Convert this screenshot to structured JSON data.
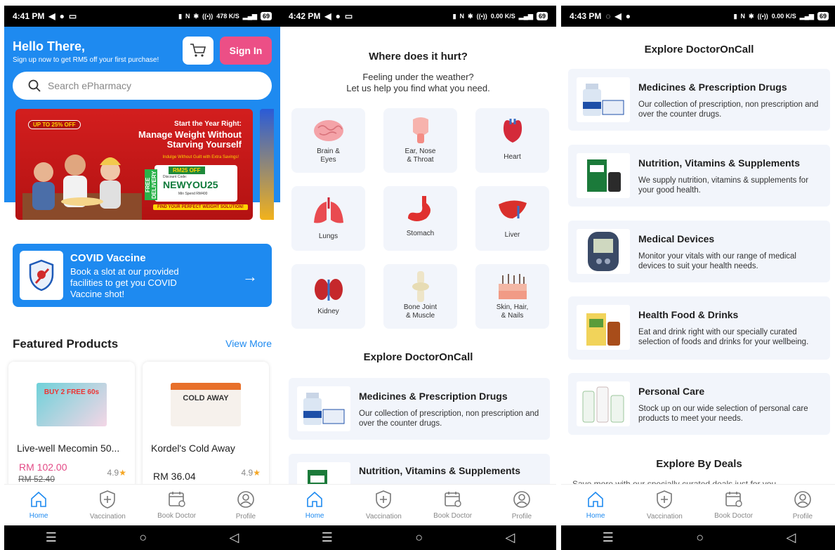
{
  "screens": [
    {
      "status": {
        "time": "4:41 PM",
        "speed": "478 K/S",
        "battery": "69"
      },
      "header": {
        "greeting": "Hello There,",
        "subtitle": "Sign up now to get RM5 off your first purchase!",
        "sign_in_label": "Sign In",
        "search_placeholder": "Search ePharmacy"
      },
      "banner": {
        "tag": "UP TO 25% OFF",
        "line1": "Start the Year Right:",
        "line2": "Manage Weight Without Starving Yourself",
        "line3": "Indulge Without Guilt with Extra Savings!",
        "free": "FREE DELIVERY",
        "off": "RM25 OFF",
        "code_label": "Discount Code:",
        "code": "NEWYOU25",
        "min_spend": "Min Spend RM400",
        "footer": "FIND YOUR PERFECT WEIGHT SOLUTION!"
      },
      "covid": {
        "title": "COVID Vaccine",
        "desc": "Book a slot at our provided facilities to get you COVID Vaccine shot!",
        "arrow": "→"
      },
      "featured": {
        "title": "Featured Products",
        "view_more": "View More",
        "products": [
          {
            "name": "Live-well Mecomin 50...",
            "price": "RM 102.00",
            "old_price": "RM 52.40",
            "rating": "4.9",
            "star": "★",
            "img_text": "BUY 2 FREE 60s"
          },
          {
            "name": "Kordel's Cold Away",
            "price": "RM 36.04",
            "rating": "4.9",
            "star": "★",
            "img_text": "COLD AWAY"
          }
        ]
      }
    },
    {
      "status": {
        "time": "4:42 PM",
        "speed": "0.00 K/S",
        "battery": "69"
      },
      "title": "Where does it hurt?",
      "subtitle_1": "Feeling under the weather?",
      "subtitle_2": "Let us help you find what you need.",
      "organs": [
        {
          "label_1": "Brain &",
          "label_2": "Eyes",
          "icon": "brain-icon"
        },
        {
          "label_1": "Ear, Nose",
          "label_2": "& Throat",
          "icon": "ear-nose-throat-icon"
        },
        {
          "label_1": "Heart",
          "label_2": "",
          "icon": "heart-icon"
        },
        {
          "label_1": "Lungs",
          "label_2": "",
          "icon": "lungs-icon"
        },
        {
          "label_1": "Stomach",
          "label_2": "",
          "icon": "stomach-icon"
        },
        {
          "label_1": "Liver",
          "label_2": "",
          "icon": "liver-icon"
        },
        {
          "label_1": "Kidney",
          "label_2": "",
          "icon": "kidney-icon"
        },
        {
          "label_1": "Bone Joint",
          "label_2": "& Muscle",
          "icon": "bone-joint-icon"
        },
        {
          "label_1": "Skin, Hair,",
          "label_2": "& Nails",
          "icon": "skin-hair-icon"
        }
      ],
      "explore_title": "Explore DoctorOnCall",
      "explore": [
        {
          "title": "Medicines & Prescription Drugs",
          "desc": "Our collection of prescription, non prescription and over the counter drugs."
        },
        {
          "title": "Nutrition, Vitamins & Supplements",
          "desc": ""
        }
      ]
    },
    {
      "status": {
        "time": "4:43 PM",
        "speed": "0.00 K/S",
        "battery": "69"
      },
      "explore_title": "Explore DoctorOnCall",
      "explore": [
        {
          "title": "Medicines & Prescription Drugs",
          "desc": "Our collection of prescription, non prescription and over the counter drugs."
        },
        {
          "title": "Nutrition, Vitamins & Supplements",
          "desc": "We supply nutrition, vitamins & supplements for your good health."
        },
        {
          "title": "Medical Devices",
          "desc": "Monitor your vitals with our range of medical devices to suit your health needs."
        },
        {
          "title": "Health Food & Drinks",
          "desc": "Eat and drink right with our specially curated selection of foods and drinks for your wellbeing."
        },
        {
          "title": "Personal Care",
          "desc": "Stock up on our wide selection of personal care products to meet your needs."
        }
      ],
      "deals_title": "Explore By Deals",
      "deals_desc": "Save more with our specially curated deals just for you"
    }
  ],
  "bottom_nav": [
    "Home",
    "Vaccination",
    "Book Doctor",
    "Profile"
  ],
  "colors": {
    "primary": "#1e8af0",
    "accent": "#ec4f86",
    "card_bg": "#f2f5fb"
  }
}
